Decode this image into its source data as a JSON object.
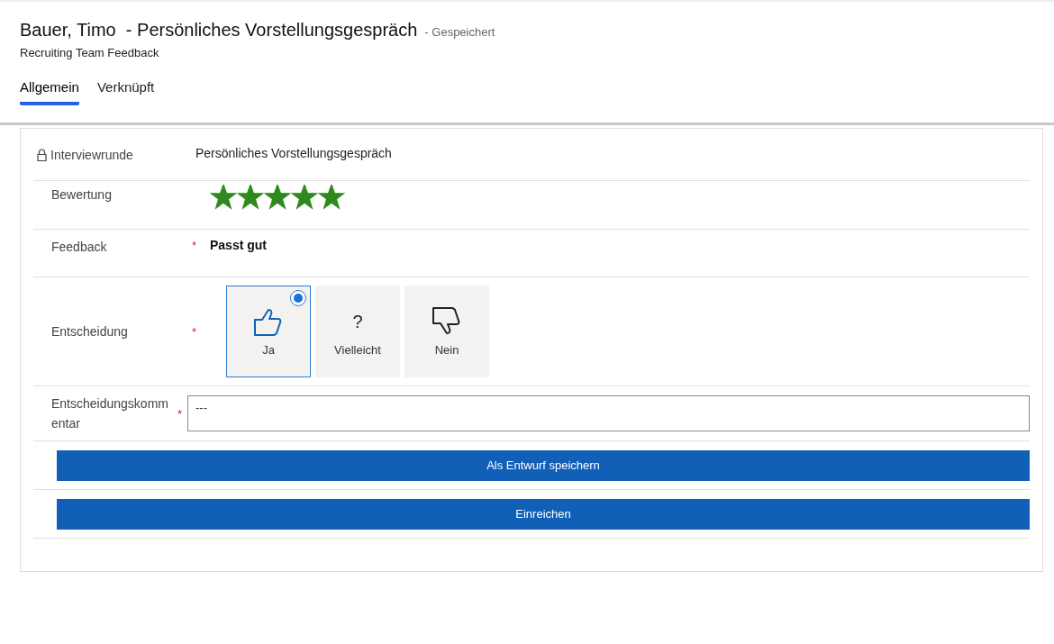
{
  "header": {
    "title": "Bauer, Timo  - Persönliches Vorstellungsgespräch",
    "status": "- Gespeichert",
    "subtitle": "Recruiting Team Feedback"
  },
  "tabs": [
    {
      "label": "Allgemein",
      "selected": true
    },
    {
      "label": "Verknüpft",
      "selected": false
    }
  ],
  "fields": [
    {
      "kind": "locked",
      "label": "Interviewrunde",
      "value": "Persönliches Vorstellungsgespräch"
    },
    {
      "kind": "rating",
      "label": "Bewertung",
      "stars": 5
    },
    {
      "kind": "text",
      "label": "Feedback",
      "required_mark": "*",
      "value": "Passt gut"
    },
    {
      "kind": "choice",
      "label": "Entscheidung",
      "required_mark": "*",
      "options": [
        {
          "kind": "positive",
          "label": "Ja",
          "selected": true
        },
        {
          "kind": "neutral",
          "glyph": "?",
          "label": "Vielleicht",
          "selected": false
        },
        {
          "kind": "negative",
          "label": "Nein",
          "selected": false
        }
      ]
    },
    {
      "kind": "textarea",
      "label": "Entscheidungskommentar",
      "required_mark": "*",
      "value": "---"
    }
  ],
  "buttons": [
    "Als Entwurf speichern",
    "Einreichen"
  ]
}
